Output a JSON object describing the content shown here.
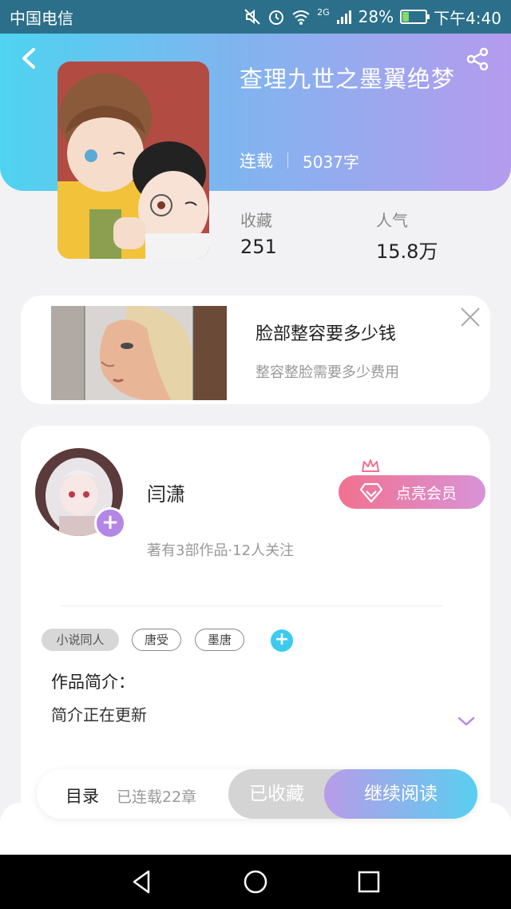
{
  "status_bar": {
    "carrier": "中国电信",
    "network": "2G",
    "battery_percent": "28%",
    "battery_level": 0.28,
    "time": "下午4:40"
  },
  "book": {
    "title": "查理九世之墨翼绝梦",
    "status": "连载",
    "word_count": "5037字",
    "favorites_label": "收藏",
    "favorites_value": "251",
    "popularity_label": "人气",
    "popularity_value": "15.8万"
  },
  "ad": {
    "title": "脸部整容要多少钱",
    "subtitle": "整容整脸需要多少费用"
  },
  "author": {
    "name": "闫潇",
    "stats": "著有3部作品·12人关注",
    "vip_label": "点亮会员"
  },
  "tags": [
    "小说同人",
    "唐受",
    "墨唐"
  ],
  "intro": {
    "title": "作品简介：",
    "text": "简介正在更新"
  },
  "action_bar": {
    "toc_label": "目录",
    "toc_sub": "已连载22章",
    "collected_label": "已收藏",
    "read_label": "继续阅读"
  },
  "colors": {
    "header_start": "#4ed3f0",
    "header_end": "#b59bee",
    "accent_purple": "#b486e6",
    "accent_cyan": "#3ccbee",
    "vip_pink": "#f2718f"
  },
  "icons": [
    "mute-icon",
    "alarm-icon",
    "wifi-icon",
    "signal-icon",
    "battery-icon",
    "back-icon",
    "share-icon",
    "close-icon",
    "add-icon",
    "crown-icon",
    "diamond-icon",
    "chevron-down-icon",
    "nav-back-icon",
    "nav-home-icon",
    "nav-recent-icon"
  ]
}
